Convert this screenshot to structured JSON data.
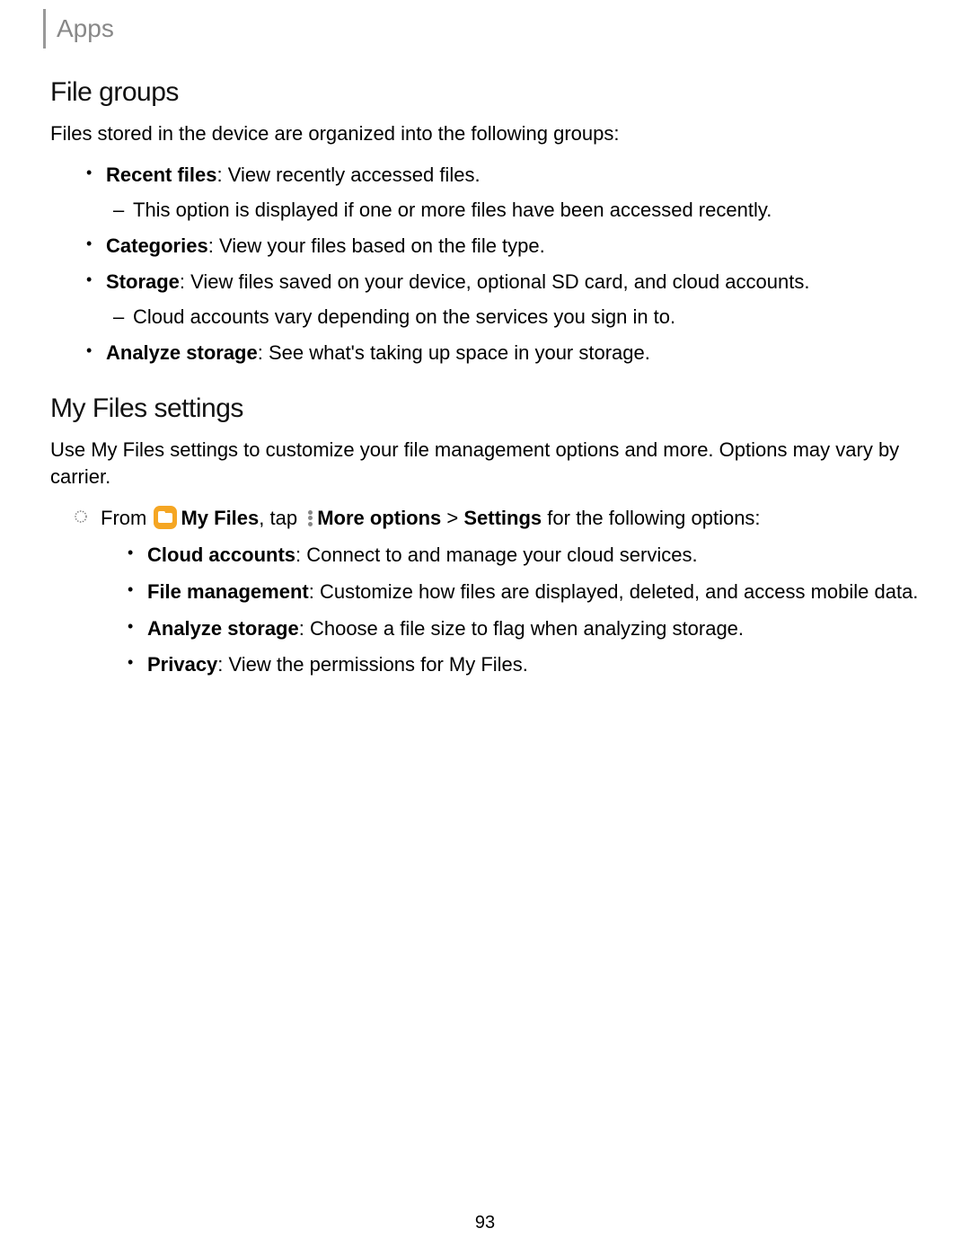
{
  "header": {
    "title": "Apps"
  },
  "section1": {
    "heading": "File groups",
    "intro": "Files stored in the device are organized into the following groups:",
    "items": [
      {
        "label": "Recent files",
        "desc": ": View recently accessed files.",
        "sub": [
          "This option is displayed if one or more files have been accessed recently."
        ]
      },
      {
        "label": "Categories",
        "desc": ": View your files based on the file type."
      },
      {
        "label": "Storage",
        "desc": ": View files saved on your device, optional SD card, and cloud accounts.",
        "sub": [
          "Cloud accounts vary depending on the services you sign in to."
        ]
      },
      {
        "label": "Analyze storage",
        "desc": ": See what's taking up space in your storage."
      }
    ]
  },
  "section2": {
    "heading": "My Files settings",
    "intro": "Use My Files settings to customize your file management options and more. Options may vary by carrier.",
    "step": {
      "prefix": "From ",
      "appName": "My Files",
      "mid1": ", tap ",
      "moreOptions": "More options",
      "arrow": " > ",
      "settings": "Settings",
      "suffix": " for the following options:"
    },
    "options": [
      {
        "label": "Cloud accounts",
        "desc": ": Connect to and manage your cloud services."
      },
      {
        "label": "File management",
        "desc": ": Customize how files are displayed, deleted, and access mobile data."
      },
      {
        "label": "Analyze storage",
        "desc": ": Choose a file size to flag when analyzing storage."
      },
      {
        "label": "Privacy",
        "desc": ": View the permissions for My Files."
      }
    ]
  },
  "pageNumber": "93"
}
